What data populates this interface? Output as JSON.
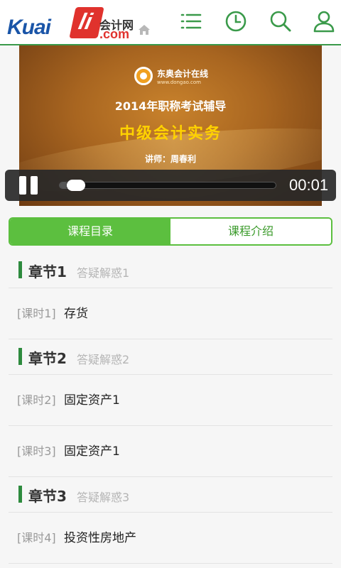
{
  "header": {
    "logo_brand": "Kuai",
    "logo_li": "li",
    "logo_cn": "会计网",
    "logo_com": ".com",
    "icons": [
      "menu-icon",
      "clock-icon",
      "search-icon",
      "user-icon"
    ],
    "accent_color": "#3a9a4a"
  },
  "video": {
    "brand_name": "东奥会计在线",
    "brand_url": "www.dongao.com",
    "title": "2014年职称考试辅导",
    "subject": "中级会计实务",
    "teacher": "讲师：周春利",
    "player": {
      "time": "00:01",
      "progress": 0.04,
      "state": "playing"
    }
  },
  "tabs": [
    {
      "label": "课程目录",
      "active": true
    },
    {
      "label": "课程介绍",
      "active": false
    }
  ],
  "chapters": [
    {
      "title": "章节1",
      "desc": "答疑解惑1",
      "lessons": [
        {
          "index": "[课时1]",
          "name": "存货"
        }
      ]
    },
    {
      "title": "章节2",
      "desc": "答疑解惑2",
      "lessons": [
        {
          "index": "[课时2]",
          "name": "固定资产1"
        },
        {
          "index": "[课时3]",
          "name": "固定资产1"
        }
      ]
    },
    {
      "title": "章节3",
      "desc": "答疑解惑3",
      "lessons": [
        {
          "index": "[课时4]",
          "name": "投资性房地产"
        }
      ]
    }
  ]
}
